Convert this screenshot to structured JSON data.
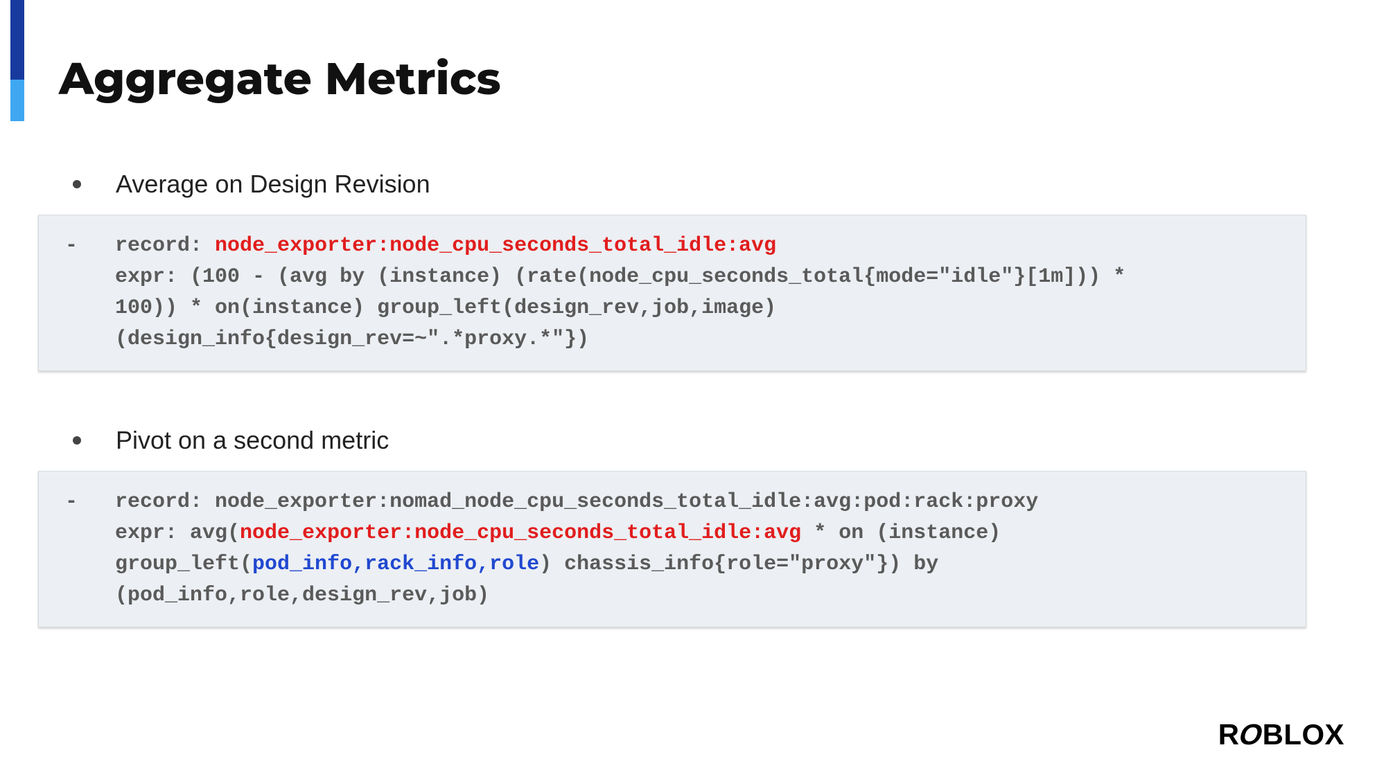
{
  "title": "Aggregate Metrics",
  "bullets": {
    "b1": "Average on Design Revision",
    "b2": "Pivot on a second metric"
  },
  "code1": {
    "l1a": "-   record: ",
    "l1b": "node_exporter:node_cpu_seconds_total_idle:avg",
    "l2": "    expr: (100 - (avg by (instance) (rate(node_cpu_seconds_total{mode=\"idle\"}[1m])) *",
    "l3": "    100)) * on(instance) group_left(design_rev,job,image)",
    "l4": "    (design_info{design_rev=~\".*proxy.*\"})"
  },
  "code2": {
    "l1": "-   record: node_exporter:nomad_node_cpu_seconds_total_idle:avg:pod:rack:proxy",
    "l2a": "    expr: avg(",
    "l2b": "node_exporter:node_cpu_seconds_total_idle:avg",
    "l2c": " * on (instance)",
    "l3a": "    group_left(",
    "l3b": "pod_info,rack_info,role",
    "l3c": ") chassis_info{role=\"proxy\"}) by",
    "l4": "    (pod_info,role,design_rev,job)"
  },
  "logo": {
    "part1": "R",
    "part2": "O",
    "part3": "BLOX"
  }
}
